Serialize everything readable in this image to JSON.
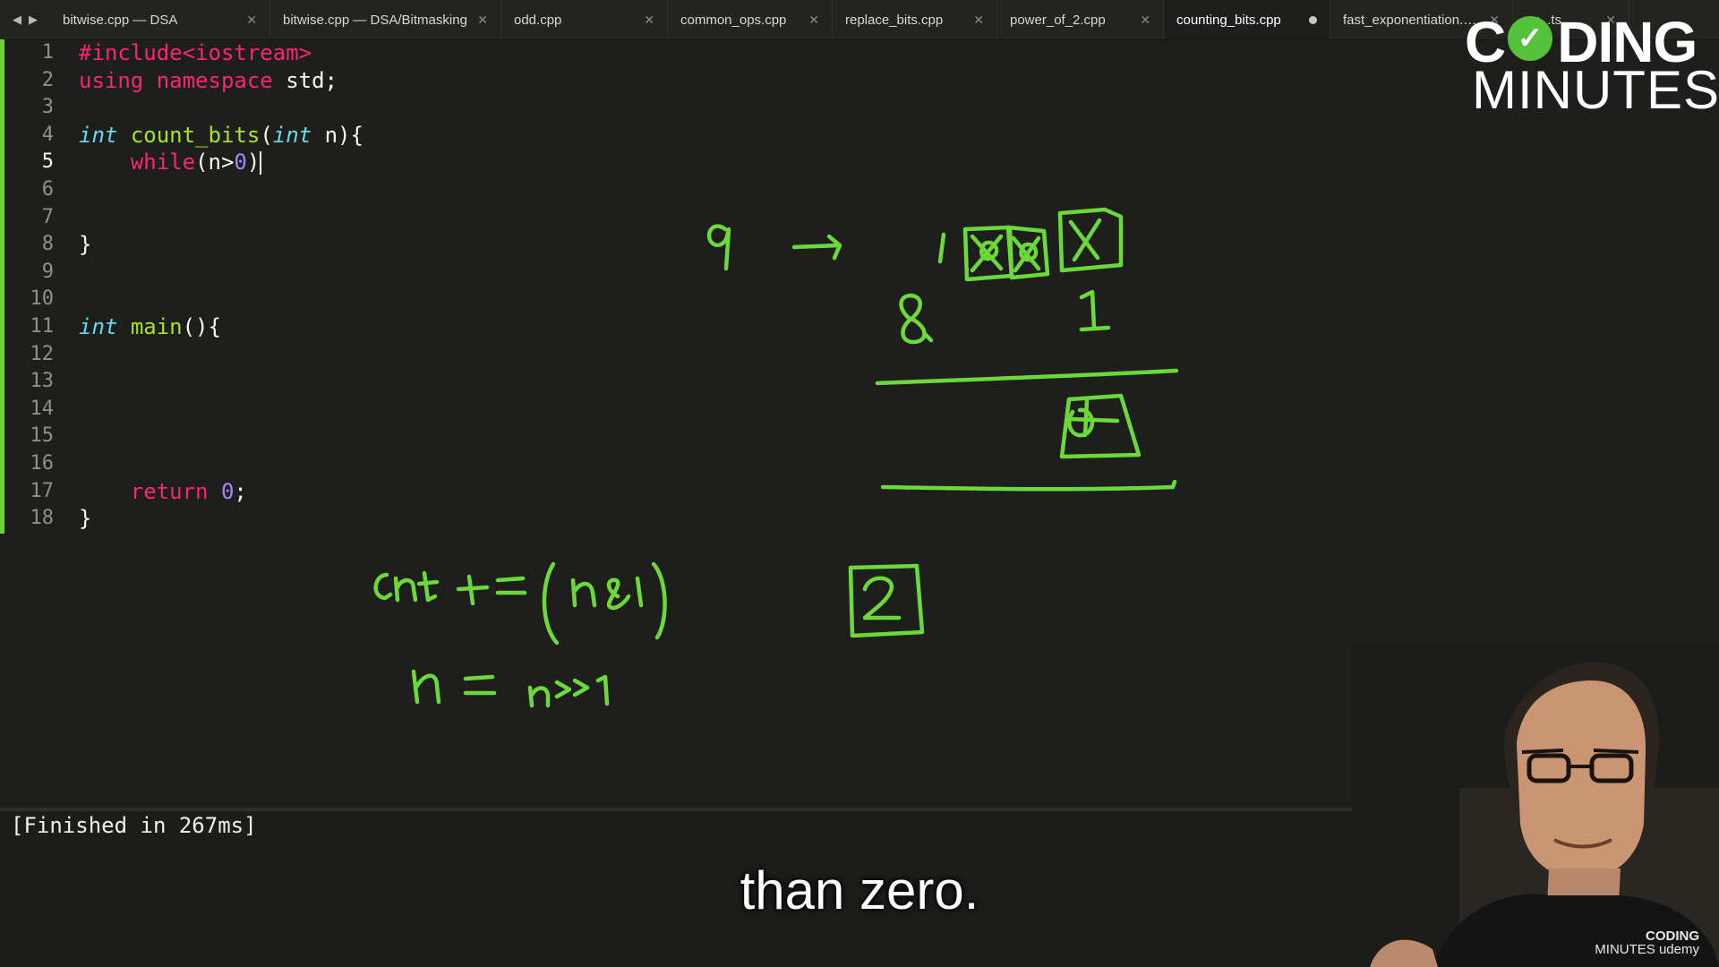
{
  "tabs": [
    {
      "label": "bitwise.cpp — DSA",
      "active": false,
      "dirty": false,
      "w": 246
    },
    {
      "label": "bitwise.cpp — DSA/Bitmasking",
      "active": false,
      "dirty": false,
      "w": 258
    },
    {
      "label": "odd.cpp",
      "active": false,
      "dirty": false,
      "w": 186
    },
    {
      "label": "common_ops.cpp",
      "active": false,
      "dirty": false,
      "w": 184
    },
    {
      "label": "replace_bits.cpp",
      "active": false,
      "dirty": false,
      "w": 184
    },
    {
      "label": "power_of_2.cpp",
      "active": false,
      "dirty": false,
      "w": 186
    },
    {
      "label": "counting_bits.cpp",
      "active": true,
      "dirty": true,
      "w": 186
    },
    {
      "label": "fast_exponentiation.cpp",
      "active": false,
      "dirty": false,
      "w": 204
    },
    {
      "label": "su...ts...",
      "active": false,
      "dirty": false,
      "w": 130
    }
  ],
  "editor": {
    "current_line": 5,
    "lines": [
      {
        "n": "1",
        "tokens": [
          {
            "t": "#include<iostream>",
            "c": "pre"
          }
        ]
      },
      {
        "n": "2",
        "tokens": [
          {
            "t": "using namespace",
            "c": "kw"
          },
          {
            "t": " std;",
            "c": "plain"
          }
        ]
      },
      {
        "n": "3",
        "tokens": []
      },
      {
        "n": "4",
        "tokens": [
          {
            "t": "int",
            "c": "type"
          },
          {
            "t": " ",
            "c": "plain"
          },
          {
            "t": "count_bits",
            "c": "fn"
          },
          {
            "t": "(",
            "c": "plain"
          },
          {
            "t": "int",
            "c": "type"
          },
          {
            "t": " n){",
            "c": "plain"
          }
        ]
      },
      {
        "n": "5",
        "tokens": [
          {
            "t": "    ",
            "c": "plain"
          },
          {
            "t": "while",
            "c": "kw"
          },
          {
            "t": "(n>",
            "c": "plain"
          },
          {
            "t": "0",
            "c": "num"
          },
          {
            "t": ")",
            "c": "plain"
          }
        ],
        "caret": true
      },
      {
        "n": "6",
        "tokens": []
      },
      {
        "n": "7",
        "tokens": []
      },
      {
        "n": "8",
        "tokens": [
          {
            "t": "}",
            "c": "plain"
          }
        ]
      },
      {
        "n": "9",
        "tokens": []
      },
      {
        "n": "10",
        "tokens": []
      },
      {
        "n": "11",
        "tokens": [
          {
            "t": "int",
            "c": "type"
          },
          {
            "t": " ",
            "c": "plain"
          },
          {
            "t": "main",
            "c": "fn"
          },
          {
            "t": "(){",
            "c": "plain"
          }
        ]
      },
      {
        "n": "12",
        "tokens": []
      },
      {
        "n": "13",
        "tokens": []
      },
      {
        "n": "14",
        "tokens": []
      },
      {
        "n": "15",
        "tokens": []
      },
      {
        "n": "16",
        "tokens": []
      },
      {
        "n": "17",
        "tokens": [
          {
            "t": "    ",
            "c": "plain"
          },
          {
            "t": "return",
            "c": "kw"
          },
          {
            "t": " ",
            "c": "plain"
          },
          {
            "t": "0",
            "c": "num"
          },
          {
            "t": ";",
            "c": "plain"
          }
        ]
      },
      {
        "n": "18",
        "tokens": [
          {
            "t": "}",
            "c": "plain"
          }
        ]
      }
    ]
  },
  "logo": {
    "line1_pre": "C",
    "line1_post": "DING",
    "line2": "MINUTES"
  },
  "output": {
    "text": "[Finished in 267ms]"
  },
  "subtitle": {
    "text": "than zero."
  },
  "webcam": {
    "watermark_a": "CODING",
    "watermark_b": "MINUTES udemy"
  },
  "colors": {
    "accent_ink": "#6cd93a",
    "gutter_modified": "#6fcf3a"
  }
}
